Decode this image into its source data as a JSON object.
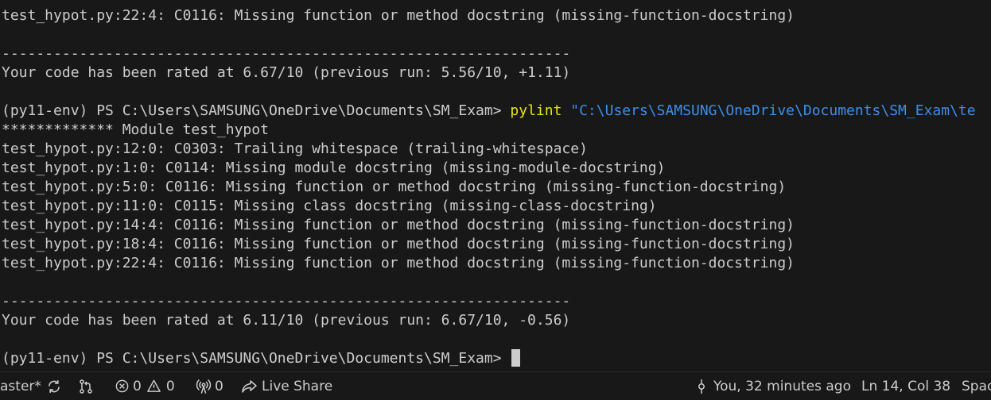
{
  "terminal": {
    "lines": {
      "l0": "test_hypot.py:22:4: C0116: Missing function or method docstring (missing-function-docstring)",
      "l2": "------------------------------------------------------------------",
      "l3": "Your code has been rated at 6.67/10 (previous run: 5.56/10, +1.11)",
      "l5_prompt": "(py11-env) PS C:\\Users\\SAMSUNG\\OneDrive\\Documents\\SM_Exam> ",
      "l5_cmd": "pylint",
      "l5_arg": " \"C:\\Users\\SAMSUNG\\OneDrive\\Documents\\SM_Exam\\te",
      "l6": "************* Module test_hypot",
      "l7": "test_hypot.py:12:0: C0303: Trailing whitespace (trailing-whitespace)",
      "l8": "test_hypot.py:1:0: C0114: Missing module docstring (missing-module-docstring)",
      "l9": "test_hypot.py:5:0: C0116: Missing function or method docstring (missing-function-docstring)",
      "l10": "test_hypot.py:11:0: C0115: Missing class docstring (missing-class-docstring)",
      "l11": "test_hypot.py:14:4: C0116: Missing function or method docstring (missing-function-docstring)",
      "l12": "test_hypot.py:18:4: C0116: Missing function or method docstring (missing-function-docstring)",
      "l13": "test_hypot.py:22:4: C0116: Missing function or method docstring (missing-function-docstring)",
      "l15": "------------------------------------------------------------------",
      "l16": "Your code has been rated at 6.11/10 (previous run: 6.67/10, -0.56)",
      "l18_prompt": "(py11-env) PS C:\\Users\\SAMSUNG\\OneDrive\\Documents\\SM_Exam> "
    },
    "colors": {
      "background": "#181818",
      "text": "#cccccc",
      "command": "#e5e510",
      "argument": "#3b8eea"
    }
  },
  "statusbar": {
    "branch": "aster*",
    "errors": "0",
    "warnings": "0",
    "ports": "0",
    "live_share": "Live Share",
    "blame": "You, 32 minutes ago",
    "cursor_position": "Ln 14, Col 38",
    "indentation": "Spac",
    "icons": {
      "sync": "sync-icon",
      "git_compare": "git-compare-icon",
      "error": "error-icon",
      "warning": "warning-icon",
      "ports": "broadcast-icon",
      "live_share": "live-share-icon",
      "blame": "git-commit-icon"
    }
  }
}
